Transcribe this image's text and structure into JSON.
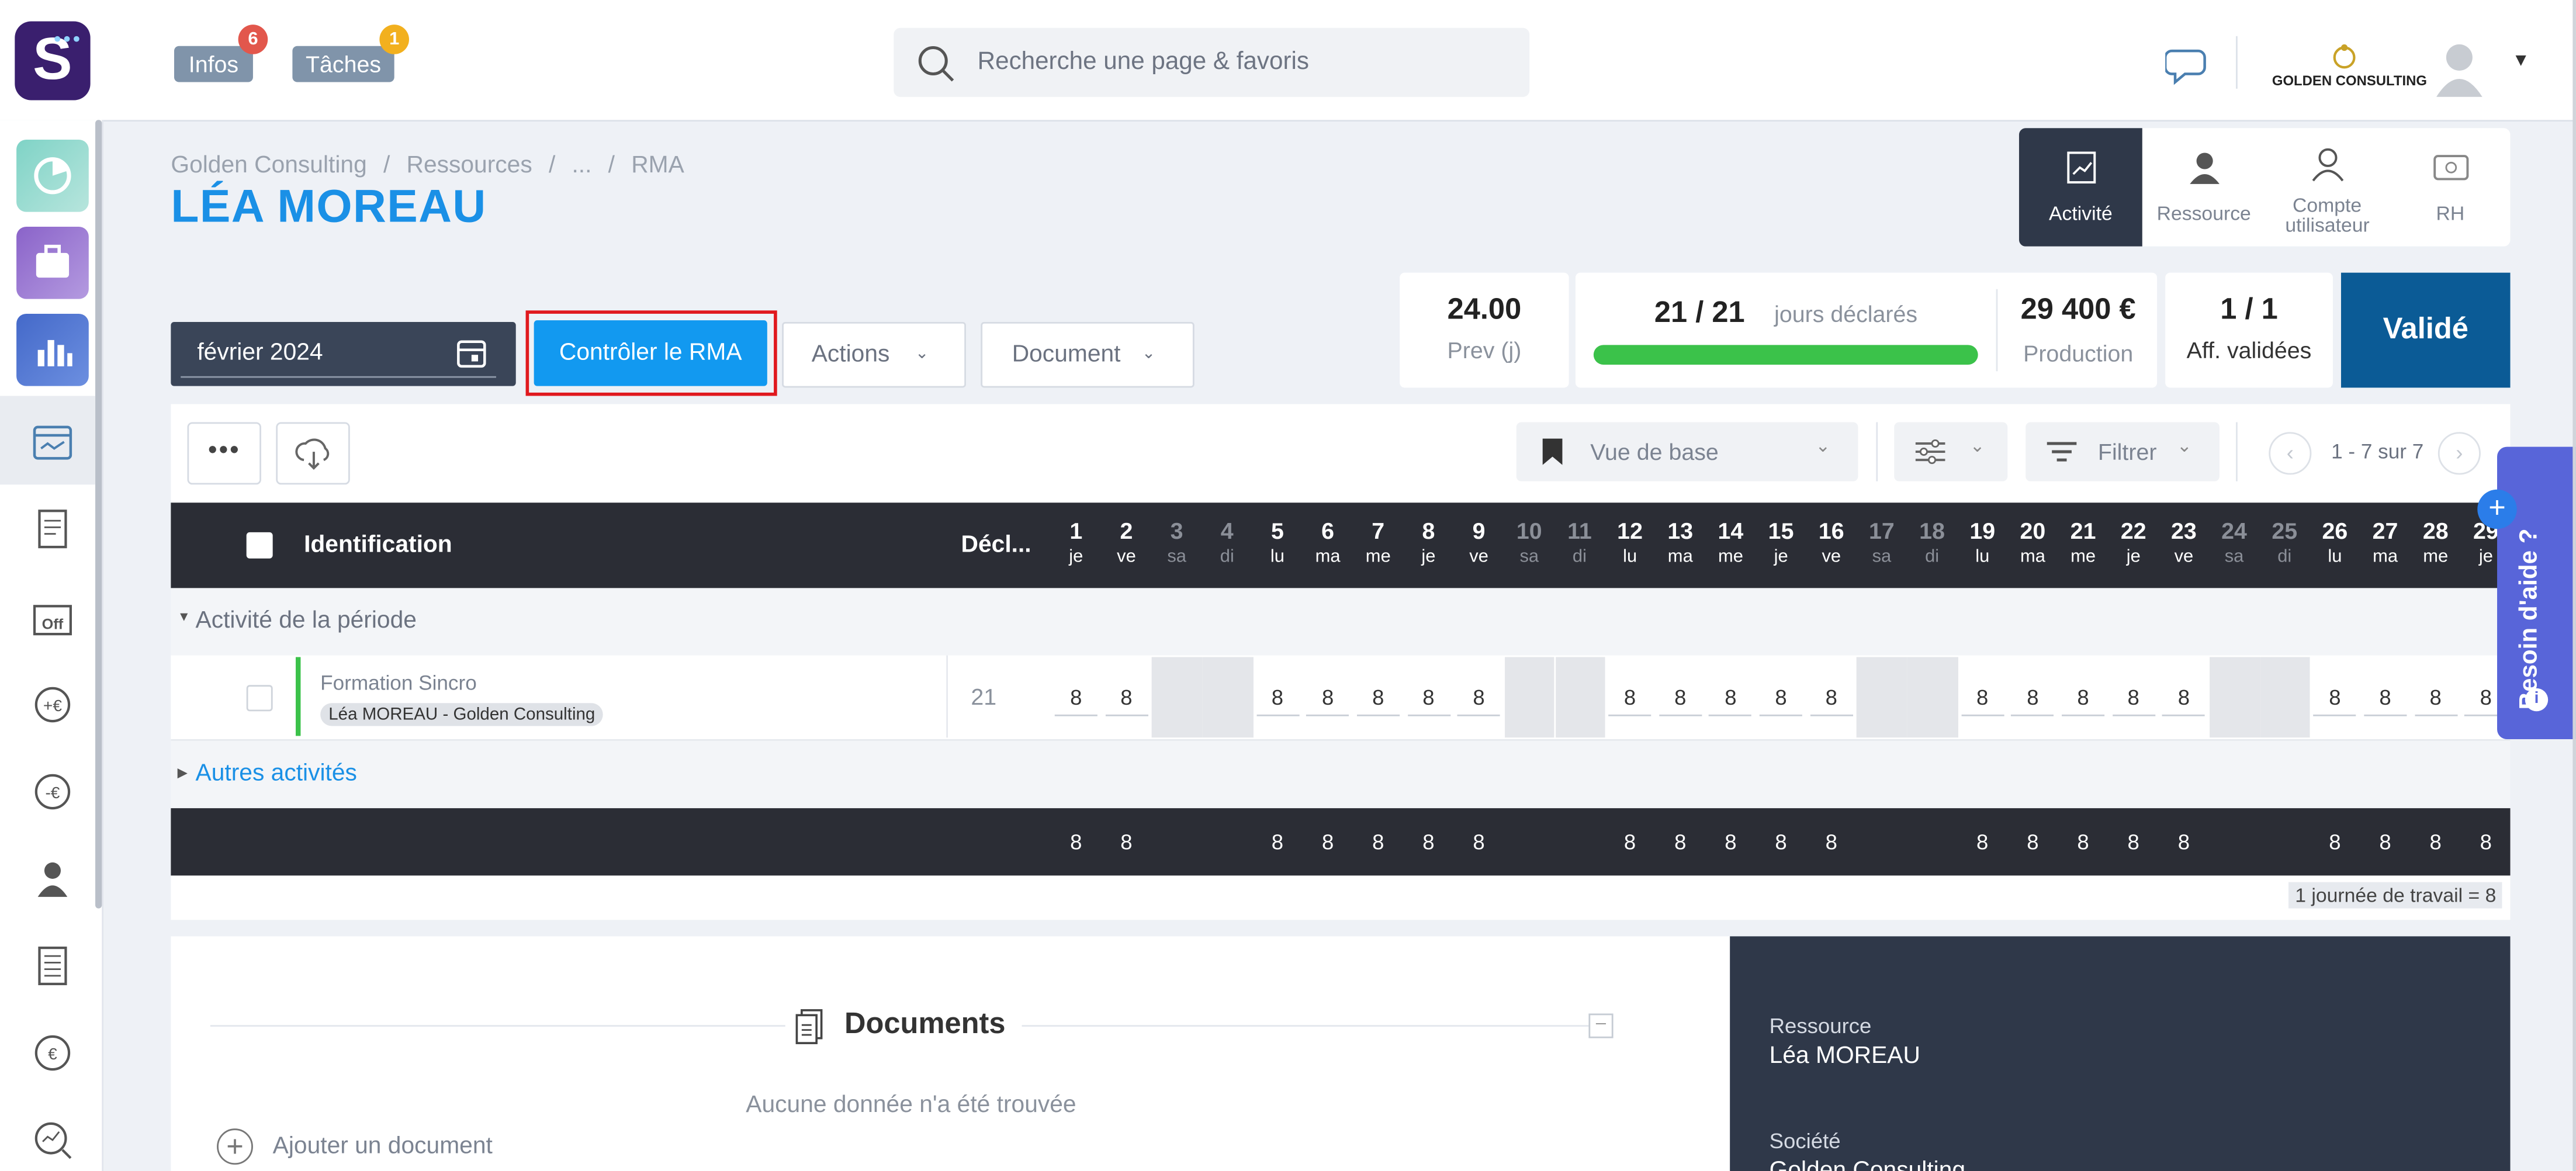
{
  "topbar": {
    "logo_letter": "S",
    "infos_label": "Infos",
    "infos_count": "6",
    "taches_label": "Tâches",
    "taches_count": "1",
    "search_placeholder": "Recherche une page & favoris",
    "company_label": "GOLDEN CONSULTING"
  },
  "breadcrumb": {
    "items": [
      "Golden Consulting",
      "Ressources",
      "...",
      "RMA"
    ],
    "separator": "/"
  },
  "page_title": "LÉA MOREAU",
  "profile_tabs": [
    {
      "label": "Activité",
      "active": true
    },
    {
      "label": "Ressource"
    },
    {
      "label": "Compte utilisateur"
    },
    {
      "label": "RH"
    }
  ],
  "toolbar": {
    "month_value": "février 2024",
    "control_button": "Contrôler le RMA",
    "actions_label": "Actions",
    "document_label": "Document"
  },
  "kpis": {
    "prev_value": "24.00",
    "prev_label": "Prev (j)",
    "declared_value": "21 / 21",
    "declared_label": "jours déclarés",
    "declared_progress": 1.0,
    "production_value": "29 400 €",
    "production_label": "Production",
    "aff_value": "1 / 1",
    "aff_label": "Aff. validées",
    "status_label": "Validé"
  },
  "grid_toolbar": {
    "view_label": "Vue de base",
    "filter_label": "Filtrer",
    "pagination": "1 - 7 sur 7"
  },
  "grid": {
    "col_identification": "Identification",
    "col_declared": "Décl...",
    "days": [
      {
        "n": "1",
        "d": "je"
      },
      {
        "n": "2",
        "d": "ve"
      },
      {
        "n": "3",
        "d": "sa"
      },
      {
        "n": "4",
        "d": "di"
      },
      {
        "n": "5",
        "d": "lu"
      },
      {
        "n": "6",
        "d": "ma"
      },
      {
        "n": "7",
        "d": "me"
      },
      {
        "n": "8",
        "d": "je"
      },
      {
        "n": "9",
        "d": "ve"
      },
      {
        "n": "10",
        "d": "sa"
      },
      {
        "n": "11",
        "d": "di"
      },
      {
        "n": "12",
        "d": "lu"
      },
      {
        "n": "13",
        "d": "ma"
      },
      {
        "n": "14",
        "d": "me"
      },
      {
        "n": "15",
        "d": "je"
      },
      {
        "n": "16",
        "d": "ve"
      },
      {
        "n": "17",
        "d": "sa"
      },
      {
        "n": "18",
        "d": "di"
      },
      {
        "n": "19",
        "d": "lu"
      },
      {
        "n": "20",
        "d": "ma"
      },
      {
        "n": "21",
        "d": "me"
      },
      {
        "n": "22",
        "d": "je"
      },
      {
        "n": "23",
        "d": "ve"
      },
      {
        "n": "24",
        "d": "sa"
      },
      {
        "n": "25",
        "d": "di"
      },
      {
        "n": "26",
        "d": "lu"
      },
      {
        "n": "27",
        "d": "ma"
      },
      {
        "n": "28",
        "d": "me"
      },
      {
        "n": "29",
        "d": "je"
      }
    ],
    "group_period": "Activité de la période",
    "row": {
      "name": "Formation Sincro",
      "tag": "Léa MOREAU - Golden Consulting",
      "declared": "21",
      "values": [
        "8",
        "8",
        "",
        "",
        "8",
        "8",
        "8",
        "8",
        "8",
        "",
        "",
        "8",
        "8",
        "8",
        "8",
        "8",
        "",
        "",
        "8",
        "8",
        "8",
        "8",
        "8",
        "",
        "",
        "8",
        "8",
        "8",
        "8"
      ]
    },
    "group_other": "Autres activités",
    "totals": [
      "8",
      "8",
      "",
      "",
      "8",
      "8",
      "8",
      "8",
      "8",
      "",
      "",
      "8",
      "8",
      "8",
      "8",
      "8",
      "",
      "",
      "8",
      "8",
      "8",
      "8",
      "8",
      "",
      "",
      "8",
      "8",
      "8",
      "8"
    ],
    "workday_note": "1 journée de travail = 8"
  },
  "documents": {
    "title": "Documents",
    "empty": "Aucune donnée n'a été trouvée",
    "add": "Ajouter un document"
  },
  "details": {
    "resource_label": "Ressource",
    "resource_value": "Léa MOREAU",
    "company_label": "Société",
    "company_value": "Golden Consulting"
  },
  "help_label": "Besoin d'aide ?"
}
